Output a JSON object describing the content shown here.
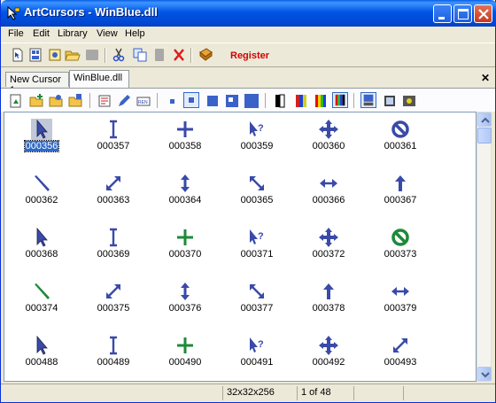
{
  "window": {
    "title": "ArtCursors - WinBlue.dll"
  },
  "menu": [
    "File",
    "Edit",
    "Library",
    "View",
    "Help"
  ],
  "toolbar": {
    "register_label": "Register"
  },
  "tabs": [
    {
      "label": "New Cursor 1"
    },
    {
      "label": "WinBlue.dll"
    }
  ],
  "cursors": [
    {
      "label": "000356",
      "icon": "arrow-icon",
      "selected": true
    },
    {
      "label": "000357",
      "icon": "ibeam-icon"
    },
    {
      "label": "000358",
      "icon": "crosshair-icon"
    },
    {
      "label": "000359",
      "icon": "help-arrow-icon"
    },
    {
      "label": "000360",
      "icon": "move-icon"
    },
    {
      "label": "000361",
      "icon": "no-icon"
    },
    {
      "label": "000362",
      "icon": "pen-icon"
    },
    {
      "label": "000363",
      "icon": "resize-nesw-icon"
    },
    {
      "label": "000364",
      "icon": "resize-ns-icon"
    },
    {
      "label": "000365",
      "icon": "resize-nwse-icon"
    },
    {
      "label": "000366",
      "icon": "resize-we-icon"
    },
    {
      "label": "000367",
      "icon": "up-arrow-icon"
    },
    {
      "label": "000368",
      "icon": "arrow-icon"
    },
    {
      "label": "000369",
      "icon": "ibeam-icon"
    },
    {
      "label": "000370",
      "icon": "crosshair-icon"
    },
    {
      "label": "000371",
      "icon": "help-arrow-icon"
    },
    {
      "label": "000372",
      "icon": "move-icon"
    },
    {
      "label": "000373",
      "icon": "no-icon"
    },
    {
      "label": "000374",
      "icon": "pen-icon"
    },
    {
      "label": "000375",
      "icon": "resize-nesw-icon"
    },
    {
      "label": "000376",
      "icon": "resize-ns-icon"
    },
    {
      "label": "000377",
      "icon": "resize-nwse-icon"
    },
    {
      "label": "000378",
      "icon": "up-arrow-icon"
    },
    {
      "label": "000379",
      "icon": "resize-we-icon"
    },
    {
      "label": "000488",
      "icon": "arrow-icon"
    },
    {
      "label": "000489",
      "icon": "ibeam-icon"
    },
    {
      "label": "000490",
      "icon": "crosshair-icon"
    },
    {
      "label": "000491",
      "icon": "help-arrow-icon"
    },
    {
      "label": "000492",
      "icon": "move-icon"
    },
    {
      "label": "000493",
      "icon": "resize-nesw-icon"
    }
  ],
  "status": {
    "size": "32x32x256",
    "page": "1 of 48"
  },
  "colors": {
    "cursor_fill": "#3a4aa8",
    "cursor_fill_light": "#5a8ee8",
    "green": "#1c8a3a",
    "register": "#d40000"
  }
}
